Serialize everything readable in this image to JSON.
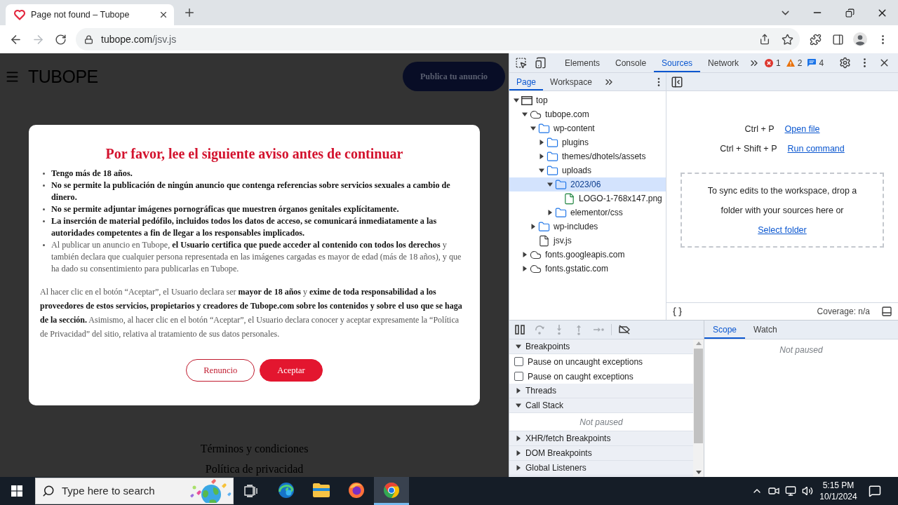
{
  "browser": {
    "tab": {
      "title": "Page not found – Tubope"
    },
    "forward": {
      "disabled": true
    },
    "address": {
      "host": "tubope.com",
      "path": "/jsv.js"
    }
  },
  "page": {
    "logo": "TUBOPE",
    "publish_button": "Publica tu anuncio",
    "modal": {
      "title": "Por favor, lee el siguiente aviso antes de continuar",
      "items": [
        "**Tengo más de 18 años.**",
        "**No se permite la publicación de ningún anuncio que contenga referencias sobre servicios sexuales a cambio de dinero.**",
        "**No se permite adjuntar imágenes pornográficas que muestren órganos genitales explícitamente.**",
        "**La inserción de material pedófilo, incluidos todos los datos de acceso, se comunicará inmediatamente a las autoridades competentes a fin de llegar a los responsables implicados.**",
        "Al publicar un anuncio en Tubope, **el Usuario certifica que puede acceder al contenido con todos los derechos** y también declara que cualquier persona representada en las imágenes cargadas es mayor de edad (más de 18 años), y que ha dado su consentimiento para publicarlas en Tubope."
      ],
      "paragraph": "Al hacer clic en el botón “Aceptar”, el Usuario declara ser **mayor de 18 años** y **exime de toda responsabilidad a los proveedores de estos servicios, propietarios y creadores de Tubope.com sobre los contenidos y sobre el uso que se haga de la sección.** Asimismo, al hacer clic en el botón “Aceptar”, el Usuario declara conocer y aceptar expresamente la “Política de Privacidad” del sitio, relativa al tratamiento de sus datos personales.",
      "buttons": [
        {
          "label": "Renuncio",
          "kind": "outline"
        },
        {
          "label": "Aceptar",
          "kind": "filled"
        }
      ]
    },
    "footer_links": [
      "Términos y condiciones",
      "Política de privacidad"
    ]
  },
  "devtools": {
    "tabs": [
      {
        "label": "Elements",
        "selected": false
      },
      {
        "label": "Console",
        "selected": false
      },
      {
        "label": "Sources",
        "selected": true
      },
      {
        "label": "Network",
        "selected": false
      }
    ],
    "issues": [
      {
        "kind": "error",
        "count": "1"
      },
      {
        "kind": "warning",
        "count": "2"
      },
      {
        "kind": "info",
        "count": "4"
      }
    ],
    "navigator_tabs": [
      {
        "label": "Page",
        "selected": true
      },
      {
        "label": "Workspace",
        "selected": false
      }
    ],
    "tree": [
      {
        "kind": "frame",
        "label": "top",
        "expanded": true,
        "selected": false,
        "children": [
          {
            "kind": "domain",
            "label": "tubope.com",
            "expanded": true,
            "selected": false,
            "children": [
              {
                "kind": "folder",
                "label": "wp-content",
                "expanded": true,
                "selected": false,
                "children": [
                  {
                    "kind": "folder",
                    "label": "plugins",
                    "expanded": false,
                    "selected": false
                  },
                  {
                    "kind": "folder",
                    "label": "themes/dhotels/assets",
                    "expanded": false,
                    "selected": false
                  },
                  {
                    "kind": "folder",
                    "label": "uploads",
                    "expanded": true,
                    "selected": false,
                    "children": [
                      {
                        "kind": "folder",
                        "label": "2023/06",
                        "expanded": true,
                        "selected": true,
                        "children": [
                          {
                            "kind": "image",
                            "label": "LOGO-1-768x147.png",
                            "selected": false
                          }
                        ]
                      },
                      {
                        "kind": "folder",
                        "label": "elementor/css",
                        "expanded": false,
                        "selected": false
                      }
                    ]
                  }
                ]
              },
              {
                "kind": "folder",
                "label": "wp-includes",
                "expanded": false,
                "selected": false
              },
              {
                "kind": "script",
                "label": "jsv.js",
                "selected": false
              }
            ]
          },
          {
            "kind": "domain",
            "label": "fonts.googleapis.com",
            "expanded": false,
            "selected": false
          },
          {
            "kind": "domain",
            "label": "fonts.gstatic.com",
            "expanded": false,
            "selected": false
          }
        ]
      }
    ],
    "shortcuts": [
      {
        "keys": "Ctrl + P",
        "action": "Open file"
      },
      {
        "keys": "Ctrl + Shift + P",
        "action": "Run command"
      }
    ],
    "drop_hint": "To sync edits to the workspace, drop a folder with your sources here or",
    "select_folder": "Select folder",
    "coverage": "Coverage: n/a",
    "stepping": {
      "disabled": true
    },
    "sections": [
      {
        "kind": "section",
        "label": "Breakpoints",
        "expanded": true
      },
      {
        "kind": "checkbox",
        "label": "Pause on uncaught exceptions",
        "checked": false
      },
      {
        "kind": "checkbox",
        "label": "Pause on caught exceptions",
        "checked": false
      },
      {
        "kind": "section",
        "label": "Threads",
        "expanded": false
      },
      {
        "kind": "section",
        "label": "Call Stack",
        "expanded": true
      },
      {
        "kind": "message",
        "label": "Not paused"
      },
      {
        "kind": "section",
        "label": "XHR/fetch Breakpoints",
        "expanded": false
      },
      {
        "kind": "section",
        "label": "DOM Breakpoints",
        "expanded": false
      },
      {
        "kind": "section",
        "label": "Global Listeners",
        "expanded": false
      }
    ],
    "sidebar_tabs": [
      {
        "label": "Scope",
        "selected": true
      },
      {
        "label": "Watch",
        "selected": false
      }
    ],
    "scope_message": "Not paused"
  },
  "taskbar": {
    "search_placeholder": "Type here to search",
    "apps": [
      {
        "kind": "edge",
        "selected": false
      },
      {
        "kind": "explorer",
        "selected": false
      },
      {
        "kind": "firefox",
        "selected": false
      },
      {
        "kind": "chrome",
        "selected": true
      }
    ],
    "time": "5:15 PM",
    "date": "10/1/2024"
  }
}
